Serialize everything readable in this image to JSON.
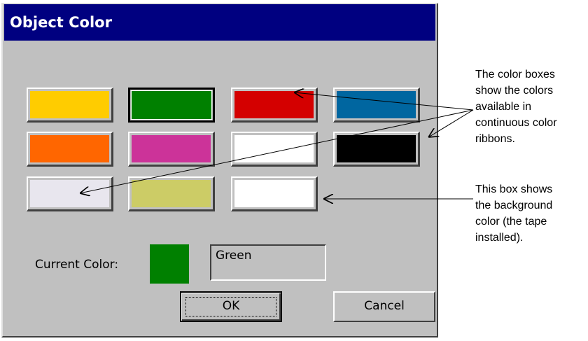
{
  "dialog": {
    "title": "Object Color",
    "swatches": [
      {
        "color": "#ffcc00"
      },
      {
        "color": "#008000",
        "selected": true
      },
      {
        "color": "#d40000"
      },
      {
        "color": "#0066a0"
      },
      {
        "color": "#ff6600"
      },
      {
        "color": "#cc3399"
      },
      {
        "color": "#ffffff"
      },
      {
        "color": "#000000"
      },
      {
        "color": "#e8e6ee"
      },
      {
        "color": "#cccc66"
      },
      {
        "color": "#ffffff"
      }
    ],
    "current_color_label": "Current Color:",
    "current_color_value": "#008000",
    "current_color_name": "Green",
    "ok_label": "OK",
    "cancel_label": "Cancel"
  },
  "annotations": {
    "color_boxes_note": [
      "The color boxes",
      "show the colors",
      "available in",
      "continuous color",
      "ribbons."
    ],
    "background_note": [
      "This box shows",
      "the background",
      "color (the tape",
      "installed)."
    ]
  }
}
